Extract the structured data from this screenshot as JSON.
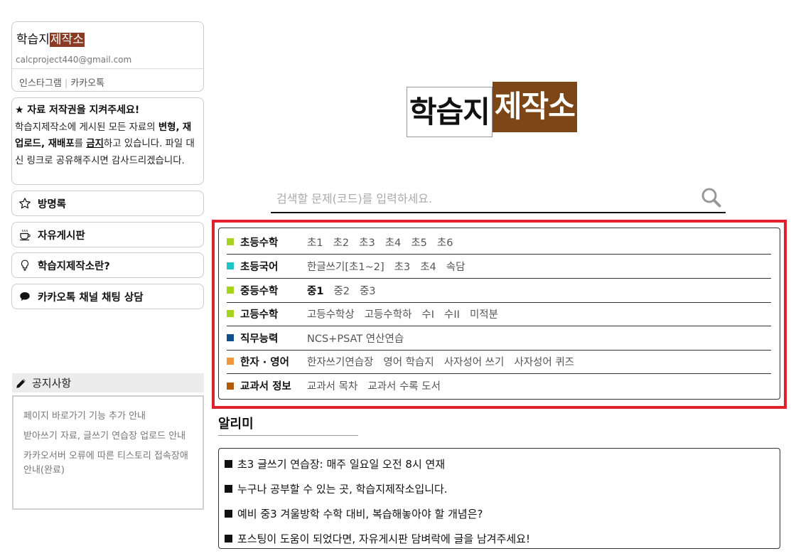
{
  "profile": {
    "title_plain": "학습지",
    "title_highlight": "제작소",
    "email": "calcproject440@gmail.com",
    "links": [
      "인스타그램",
      "카카오톡"
    ]
  },
  "copyright": {
    "heading": "★ 자료 저작권을 지켜주세요!",
    "line1_pre": "학습지제작소에 게시된 모든 자료의 ",
    "line1_bold": "변형,",
    "line2_bold": "재업로드, 재배포",
    "line2_mid": "를 ",
    "line2_u": "금지",
    "line2_post": "하고 있습니다.",
    "line3": "파일 대신 링크로 공유해주시면 감사드리겠습니다."
  },
  "side_menu": [
    {
      "label": "방명록",
      "icon": "star-outline-icon"
    },
    {
      "label": "자유게시판",
      "icon": "coffee-cup-icon"
    },
    {
      "label": "학습지제작소란?",
      "icon": "lightbulb-icon"
    },
    {
      "label": "카카오톡 채널 채팅 상담",
      "icon": "speech-bubble-icon"
    }
  ],
  "notice": {
    "heading": "공지사항",
    "items": [
      "페이지 바로가기 기능 추가 안내",
      "받아쓰기 자료, 글쓰기 연습장 업로드 안내",
      "카카오서버 오류에 따른 티스토리 접속장애 안내(완료)"
    ]
  },
  "logo": {
    "plain": "학습지",
    "highlight": "제작소"
  },
  "search": {
    "placeholder": "검색할 문제(코드)를 입력하세요.",
    "value": ""
  },
  "categories": [
    {
      "name": "초등수학",
      "color": "#a6d41c",
      "links": [
        "초1",
        "초2",
        "초3",
        "초4",
        "초5",
        "초6"
      ],
      "strong": []
    },
    {
      "name": "초등국어",
      "color": "#1cc4c4",
      "links": [
        "한글쓰기[초1~2]",
        "초3",
        "초4",
        "속담"
      ],
      "strong": []
    },
    {
      "name": "중등수학",
      "color": "#a6d41c",
      "links": [
        "중1",
        "중2",
        "중3"
      ],
      "strong": [
        "중1"
      ]
    },
    {
      "name": "고등수학",
      "color": "#a6d41c",
      "links": [
        "고등수학상",
        "고등수학하",
        "수I",
        "수II",
        "미적분"
      ],
      "strong": []
    },
    {
      "name": "직무능력",
      "color": "#0f4f8c",
      "links": [
        "NCS+PSAT 연산연습"
      ],
      "strong": []
    },
    {
      "name": "한자 · 영어",
      "color": "#f0963c",
      "links": [
        "한자쓰기연습장",
        "영어 학습지",
        "사자성어 쓰기",
        "사자성어 퀴즈"
      ],
      "strong": []
    },
    {
      "name": "교과서 정보",
      "color": "#b35a0a",
      "links": [
        "교과서 목차",
        "교과서 수록 도서"
      ],
      "strong": []
    }
  ],
  "alimi": {
    "title": "알리미",
    "items": [
      "초3 글쓰기 연습장: 매주 일요일 오전 8시 연재",
      "누구나 공부할 수 있는 곳, 학습지제작소입니다.",
      "예비 중3 겨울방학 수학 대비, 복습해놓아야 할 개념은?",
      "포스팅이 도움이 되었다면, 자유게시판 담벼락에 글을 남겨주세요!"
    ]
  }
}
